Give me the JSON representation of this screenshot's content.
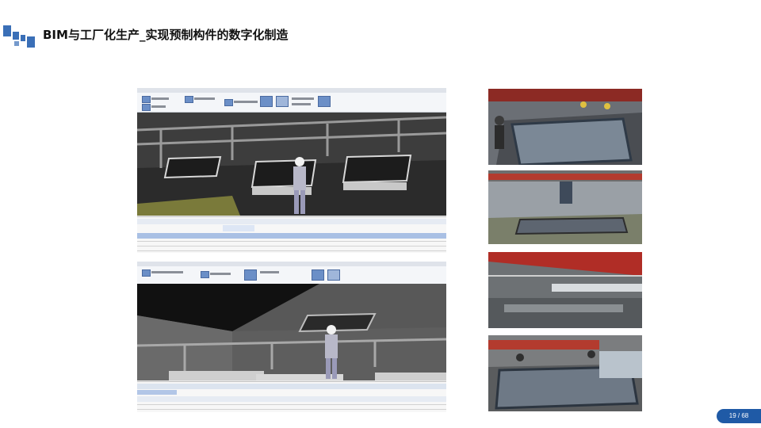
{
  "slide": {
    "title": "BIM与工厂化生产_实现预制构件的数字化制造",
    "page_number": "19 / 68"
  },
  "colors": {
    "accent": "#1f5aa6",
    "logo": "#3a6fb7"
  },
  "icons": {
    "logo": "blue-squares-logo"
  },
  "screenshots": [
    {
      "name": "bim-model-view-top"
    },
    {
      "name": "bim-model-view-bottom"
    }
  ],
  "photos": [
    {
      "name": "factory-photo-mold-assembly"
    },
    {
      "name": "factory-photo-crane-mold"
    },
    {
      "name": "factory-photo-workshop-overview"
    },
    {
      "name": "factory-photo-workers-mold"
    }
  ]
}
